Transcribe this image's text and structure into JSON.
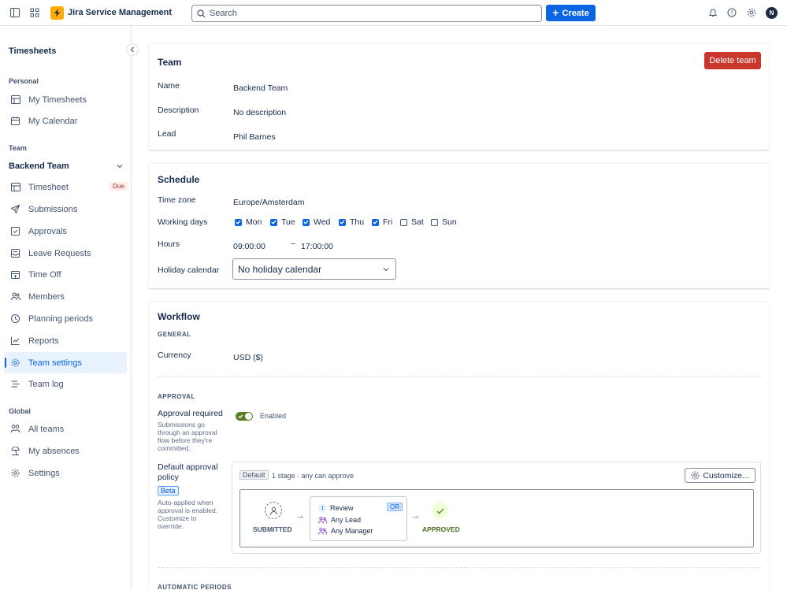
{
  "topbar": {
    "app_name": "Jira Service Management",
    "search_placeholder": "Search",
    "create_label": "Create",
    "avatar_initial": "N"
  },
  "sidebar": {
    "title": "Timesheets",
    "sections": {
      "personal": "Personal",
      "team": "Team",
      "global": "Global"
    },
    "personal_items": [
      {
        "label": "My Timesheets",
        "icon": "table-icon"
      },
      {
        "label": "My Calendar",
        "icon": "calendar-icon"
      }
    ],
    "team_name": "Backend Team",
    "team_items": [
      {
        "label": "Timesheet",
        "icon": "table-icon",
        "badge": "Due"
      },
      {
        "label": "Submissions",
        "icon": "send-icon"
      },
      {
        "label": "Approvals",
        "icon": "checkbox-icon"
      },
      {
        "label": "Leave Requests",
        "icon": "inbox-icon"
      },
      {
        "label": "Time Off",
        "icon": "calendar-plus-icon"
      },
      {
        "label": "Members",
        "icon": "people-icon"
      },
      {
        "label": "Planning periods",
        "icon": "clock-icon"
      },
      {
        "label": "Reports",
        "icon": "chart-icon"
      },
      {
        "label": "Team settings",
        "icon": "gear-icon"
      },
      {
        "label": "Team log",
        "icon": "list-icon"
      }
    ],
    "global_items": [
      {
        "label": "All teams",
        "icon": "group-icon"
      },
      {
        "label": "My absences",
        "icon": "beach-icon"
      },
      {
        "label": "Settings",
        "icon": "gear-icon"
      }
    ]
  },
  "team_card": {
    "title": "Team",
    "delete_label": "Delete team",
    "name_label": "Name",
    "name_value": "Backend Team",
    "description_label": "Description",
    "description_value": "No description",
    "lead_label": "Lead",
    "lead_value": "Phil Barnes"
  },
  "schedule_card": {
    "title": "Schedule",
    "timezone_label": "Time zone",
    "timezone_value": "Europe/Amsterdam",
    "working_days_label": "Working days",
    "days": [
      {
        "label": "Mon",
        "checked": true
      },
      {
        "label": "Tue",
        "checked": true
      },
      {
        "label": "Wed",
        "checked": true
      },
      {
        "label": "Thu",
        "checked": true
      },
      {
        "label": "Fri",
        "checked": true
      },
      {
        "label": "Sat",
        "checked": false
      },
      {
        "label": "Sun",
        "checked": false
      }
    ],
    "hours_label": "Hours",
    "hours_start": "09:00:00",
    "hours_separator": "–",
    "hours_end": "17:00:00",
    "holiday_label": "Holiday calendar",
    "holiday_value": "No holiday calendar"
  },
  "workflow_card": {
    "title": "Workflow",
    "general_heading": "GENERAL",
    "currency_label": "Currency",
    "currency_value": "USD ($)",
    "approval_heading": "APPROVAL",
    "approval_required_label": "Approval required",
    "approval_required_desc": "Submissions go through an approval flow before they're committed.",
    "approval_toggle_text": "Enabled",
    "policy_label": "Default approval policy",
    "beta_label": "Beta",
    "policy_desc": "Auto-applied when approval is enabled. Customize to override.",
    "default_tag": "Default",
    "stage_info": "1 stage · any can approve",
    "customize_label": "Customize...",
    "submitted_label": "SUBMITTED",
    "review_step_number": "1",
    "review_label": "Review",
    "or_label": "OR",
    "approvers": [
      "Any Lead",
      "Any Manager"
    ],
    "approved_label": "APPROVED",
    "automatic_heading": "AUTOMATIC PERIODS"
  },
  "colors": {
    "accent": "#0c66e4",
    "danger": "#c9372c",
    "success": "#5b7f24",
    "badge_due": "#ae2e24"
  }
}
